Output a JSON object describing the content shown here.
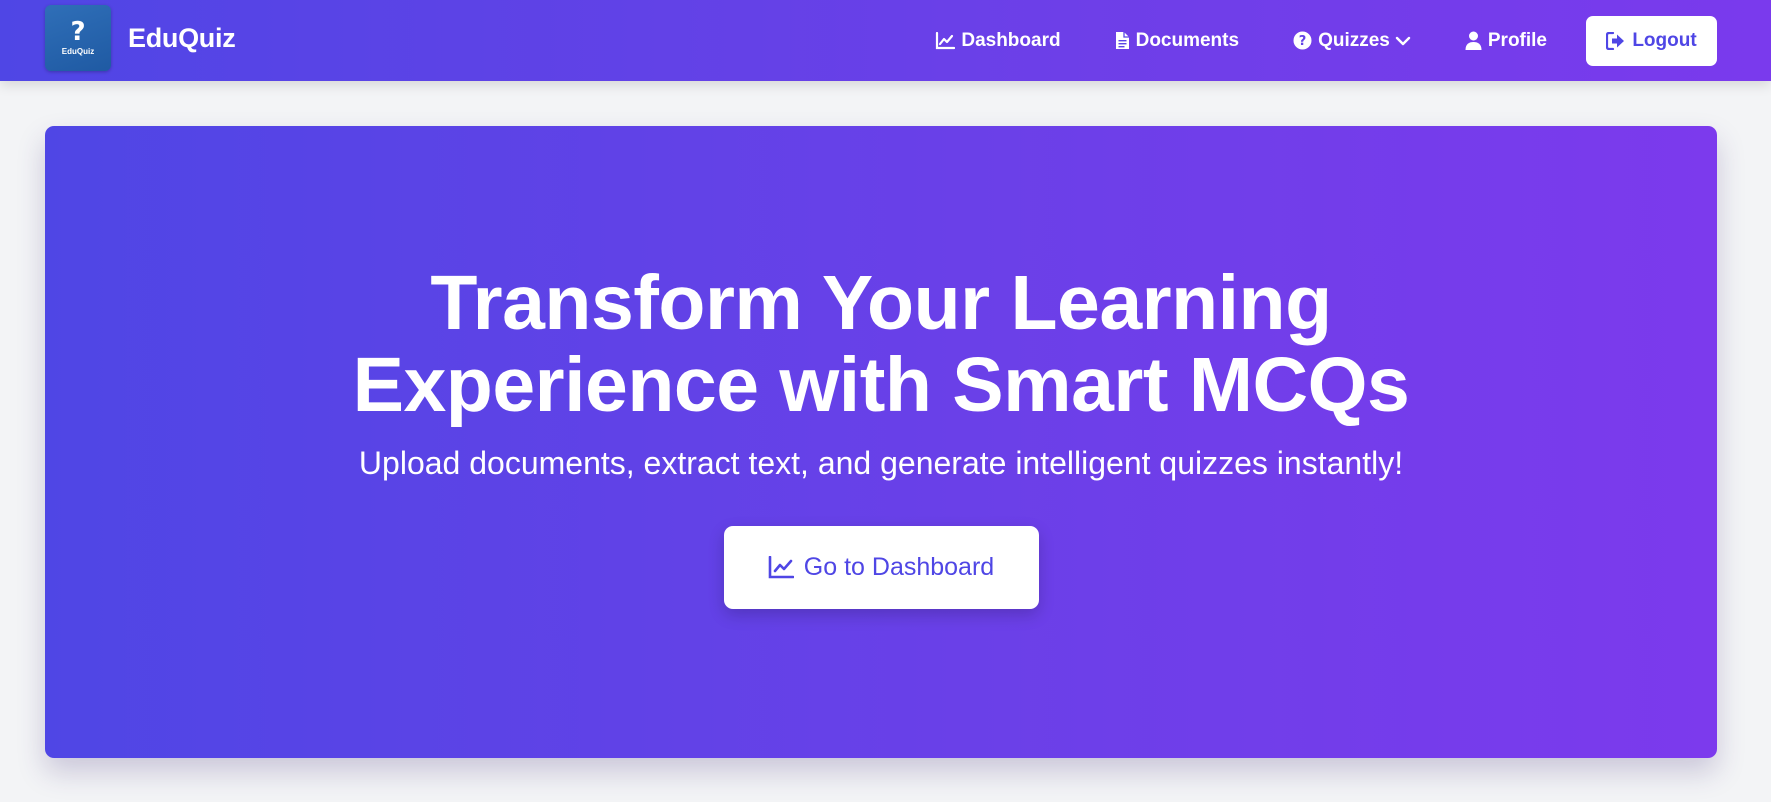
{
  "brand": {
    "logo_glyph": "?",
    "logo_text": "EduQuiz",
    "name": "EduQuiz"
  },
  "nav": {
    "dashboard": "Dashboard",
    "documents": "Documents",
    "quizzes": "Quizzes",
    "profile": "Profile",
    "logout": "Logout"
  },
  "hero": {
    "title_line1": "Transform Your Learning",
    "title_line2": "Experience with Smart MCQs",
    "subtitle": "Upload documents, extract text, and generate intelligent quizzes instantly!",
    "cta_label": "Go to Dashboard"
  },
  "colors": {
    "primary": "#4f46e5",
    "secondary": "#7c3aed",
    "background": "#f3f4f6"
  },
  "icons": {
    "dashboard": "chart-line-icon",
    "documents": "file-icon",
    "quizzes": "question-circle-icon",
    "quizzes_caret": "chevron-down-icon",
    "profile": "user-icon",
    "logout": "sign-out-icon",
    "cta": "chart-line-icon"
  }
}
